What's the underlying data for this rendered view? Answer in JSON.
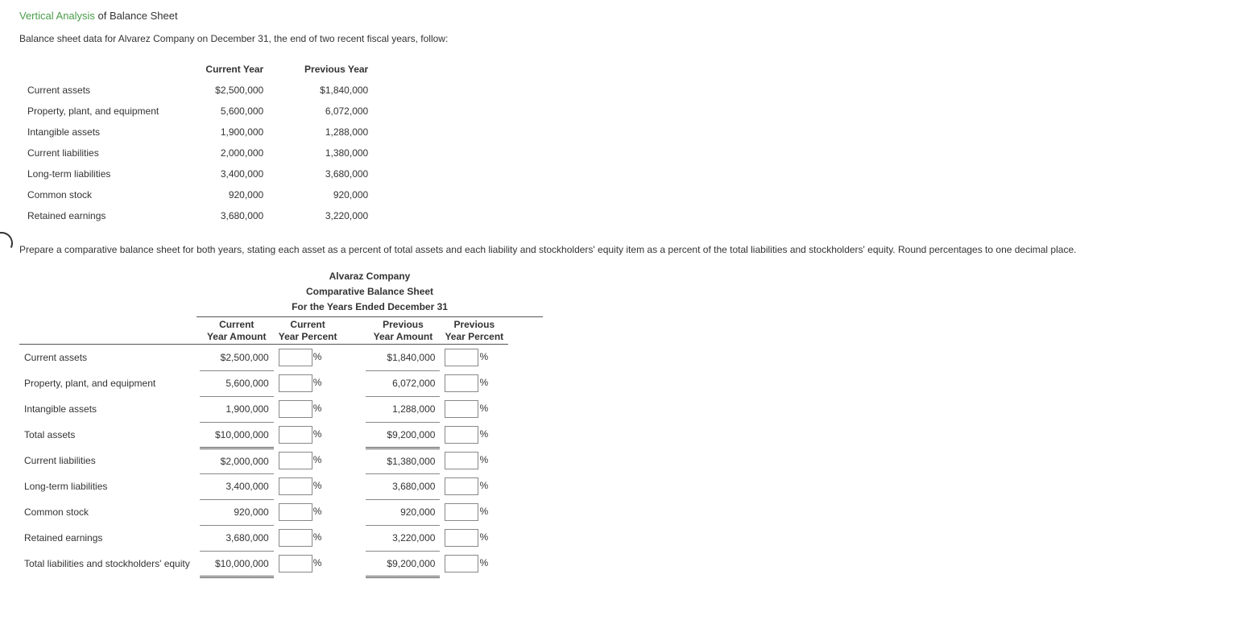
{
  "heading": {
    "link": "Vertical Analysis",
    "rest": " of Balance Sheet"
  },
  "intro": "Balance sheet data for Alvarez Company on December 31, the end of two recent fiscal years, follow:",
  "dataTable": {
    "headers": [
      "",
      "Current Year",
      "Previous Year"
    ],
    "rows": [
      {
        "label": "Current assets",
        "cur": "$2,500,000",
        "prev": "$1,840,000"
      },
      {
        "label": "Property, plant, and equipment",
        "cur": "5,600,000",
        "prev": "6,072,000"
      },
      {
        "label": "Intangible assets",
        "cur": "1,900,000",
        "prev": "1,288,000"
      },
      {
        "label": "Current liabilities",
        "cur": "2,000,000",
        "prev": "1,380,000"
      },
      {
        "label": "Long-term liabilities",
        "cur": "3,400,000",
        "prev": "3,680,000"
      },
      {
        "label": "Common stock",
        "cur": "920,000",
        "prev": "920,000"
      },
      {
        "label": "Retained earnings",
        "cur": "3,680,000",
        "prev": "3,220,000"
      }
    ]
  },
  "instructions": "Prepare a comparative balance sheet for both years, stating each asset as a percent of total assets and each liability and stockholders' equity item as a percent of the total liabilities and stockholders' equity. Round percentages to one decimal place.",
  "sheet": {
    "title1": "Alvaraz Company",
    "title2": "Comparative Balance Sheet",
    "title3": "For the Years Ended December 31",
    "colHeaders": {
      "curAmt": "Current\nYear Amount",
      "curPct": "Current\nYear Percent",
      "prevAmt": "Previous\nYear Amount",
      "prevPct": "Previous\nYear Percent"
    },
    "pctSign": "%",
    "rows": [
      {
        "label": "Current assets",
        "curAmt": "$2,500,000",
        "prevAmt": "$1,840,000",
        "total": false
      },
      {
        "label": "Property, plant, and equipment",
        "curAmt": "5,600,000",
        "prevAmt": "6,072,000",
        "total": false
      },
      {
        "label": "Intangible assets",
        "curAmt": "1,900,000",
        "prevAmt": "1,288,000",
        "total": false
      },
      {
        "label": "Total assets",
        "curAmt": "$10,000,000",
        "prevAmt": "$9,200,000",
        "total": true
      },
      {
        "label": "Current liabilities",
        "curAmt": "$2,000,000",
        "prevAmt": "$1,380,000",
        "total": false
      },
      {
        "label": "Long-term liabilities",
        "curAmt": "3,400,000",
        "prevAmt": "3,680,000",
        "total": false
      },
      {
        "label": "Common stock",
        "curAmt": "920,000",
        "prevAmt": "920,000",
        "total": false
      },
      {
        "label": "Retained earnings",
        "curAmt": "3,680,000",
        "prevAmt": "3,220,000",
        "total": false
      },
      {
        "label": "Total liabilities and stockholders' equity",
        "curAmt": "$10,000,000",
        "prevAmt": "$9,200,000",
        "total": true
      }
    ]
  }
}
